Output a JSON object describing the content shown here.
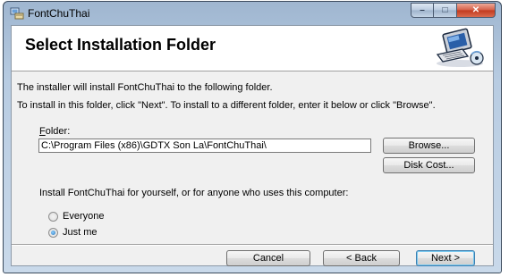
{
  "window": {
    "title": "FontChuThai",
    "minimize_glyph": "–",
    "maximize_glyph": "□",
    "close_glyph": "✕"
  },
  "banner": {
    "title": "Select Installation Folder",
    "graphic_icon": "computer-disk-icon"
  },
  "main": {
    "intro_text": "The installer will install FontChuThai to the following folder.",
    "instructions_text": "To install in this folder, click \"Next\". To install to a different folder, enter it below or click \"Browse\".",
    "folder_label_mnemonic": "F",
    "folder_label_rest": "older:",
    "folder_value": "C:\\Program Files (x86)\\GDTX Son La\\FontChuThai\\",
    "browse_label": "Browse...",
    "disk_cost_label": "Disk Cost...",
    "scope_question": "Install FontChuThai for yourself, or for anyone who uses this computer:",
    "options": [
      {
        "label": "Everyone",
        "selected": false
      },
      {
        "label": "Just me",
        "selected": true
      }
    ]
  },
  "footer": {
    "cancel_label": "Cancel",
    "back_label": "< Back",
    "next_label": "Next >"
  },
  "colors": {
    "title_bar": "#b8cce2",
    "client_bg": "#f0f0f0",
    "close_button": "#c2391d",
    "default_button_border": "#3c7fb1"
  }
}
